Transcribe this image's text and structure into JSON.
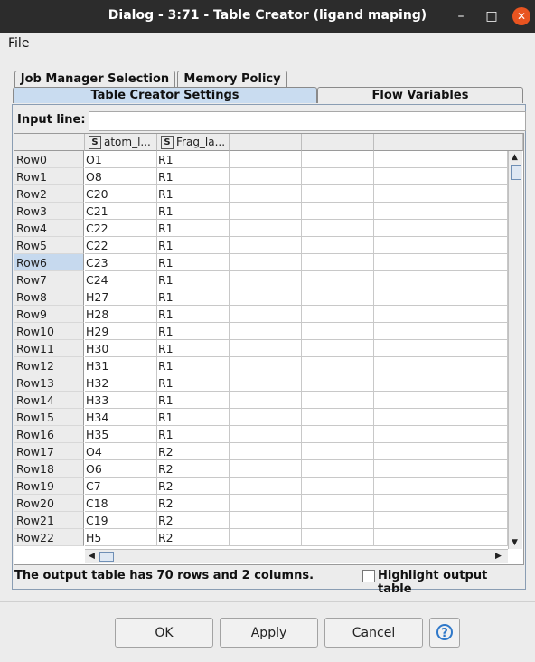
{
  "window": {
    "title": "Dialog - 3:71 - Table Creator (ligand maping)",
    "minimize_glyph": "–",
    "maximize_glyph": "□",
    "close_glyph": "✕"
  },
  "menu": {
    "file": "File"
  },
  "tabs": {
    "row1": [
      "Job Manager Selection",
      "Memory Policy"
    ],
    "row2": [
      "Table Creator Settings",
      "Flow Variables"
    ],
    "active": "Table Creator Settings"
  },
  "input_line": {
    "label": "Input line:",
    "value": ""
  },
  "table": {
    "columns": [
      {
        "type_badge": "S",
        "name": "atom_l..."
      },
      {
        "type_badge": "S",
        "name": "Frag_la..."
      }
    ],
    "selected_row": "Row6",
    "rows": [
      {
        "id": "Row0",
        "atom": "O1",
        "frag": "R1"
      },
      {
        "id": "Row1",
        "atom": "O8",
        "frag": "R1"
      },
      {
        "id": "Row2",
        "atom": "C20",
        "frag": "R1"
      },
      {
        "id": "Row3",
        "atom": "C21",
        "frag": "R1"
      },
      {
        "id": "Row4",
        "atom": "C22",
        "frag": "R1"
      },
      {
        "id": "Row5",
        "atom": "C22",
        "frag": "R1"
      },
      {
        "id": "Row6",
        "atom": "C23",
        "frag": "R1"
      },
      {
        "id": "Row7",
        "atom": "C24",
        "frag": "R1"
      },
      {
        "id": "Row8",
        "atom": "H27",
        "frag": "R1"
      },
      {
        "id": "Row9",
        "atom": "H28",
        "frag": "R1"
      },
      {
        "id": "Row10",
        "atom": "H29",
        "frag": "R1"
      },
      {
        "id": "Row11",
        "atom": "H30",
        "frag": "R1"
      },
      {
        "id": "Row12",
        "atom": "H31",
        "frag": "R1"
      },
      {
        "id": "Row13",
        "atom": "H32",
        "frag": "R1"
      },
      {
        "id": "Row14",
        "atom": "H33",
        "frag": "R1"
      },
      {
        "id": "Row15",
        "atom": "H34",
        "frag": "R1"
      },
      {
        "id": "Row16",
        "atom": "H35",
        "frag": "R1"
      },
      {
        "id": "Row17",
        "atom": "O4",
        "frag": "R2"
      },
      {
        "id": "Row18",
        "atom": "O6",
        "frag": "R2"
      },
      {
        "id": "Row19",
        "atom": "C7",
        "frag": "R2"
      },
      {
        "id": "Row20",
        "atom": "C18",
        "frag": "R2"
      },
      {
        "id": "Row21",
        "atom": "C19",
        "frag": "R2"
      },
      {
        "id": "Row22",
        "atom": "H5",
        "frag": "R2"
      }
    ]
  },
  "status": {
    "text": "The output table has 70 rows and 2 columns.",
    "highlight_label": "Highlight output table",
    "highlight_checked": false
  },
  "buttons": {
    "ok": "OK",
    "apply": "Apply",
    "cancel": "Cancel",
    "help": "?"
  },
  "colors": {
    "titlebar": "#2c2c2c",
    "close": "#e95420",
    "active_tab": "#c9dcf0",
    "selected_row": "#c6d9ee"
  }
}
